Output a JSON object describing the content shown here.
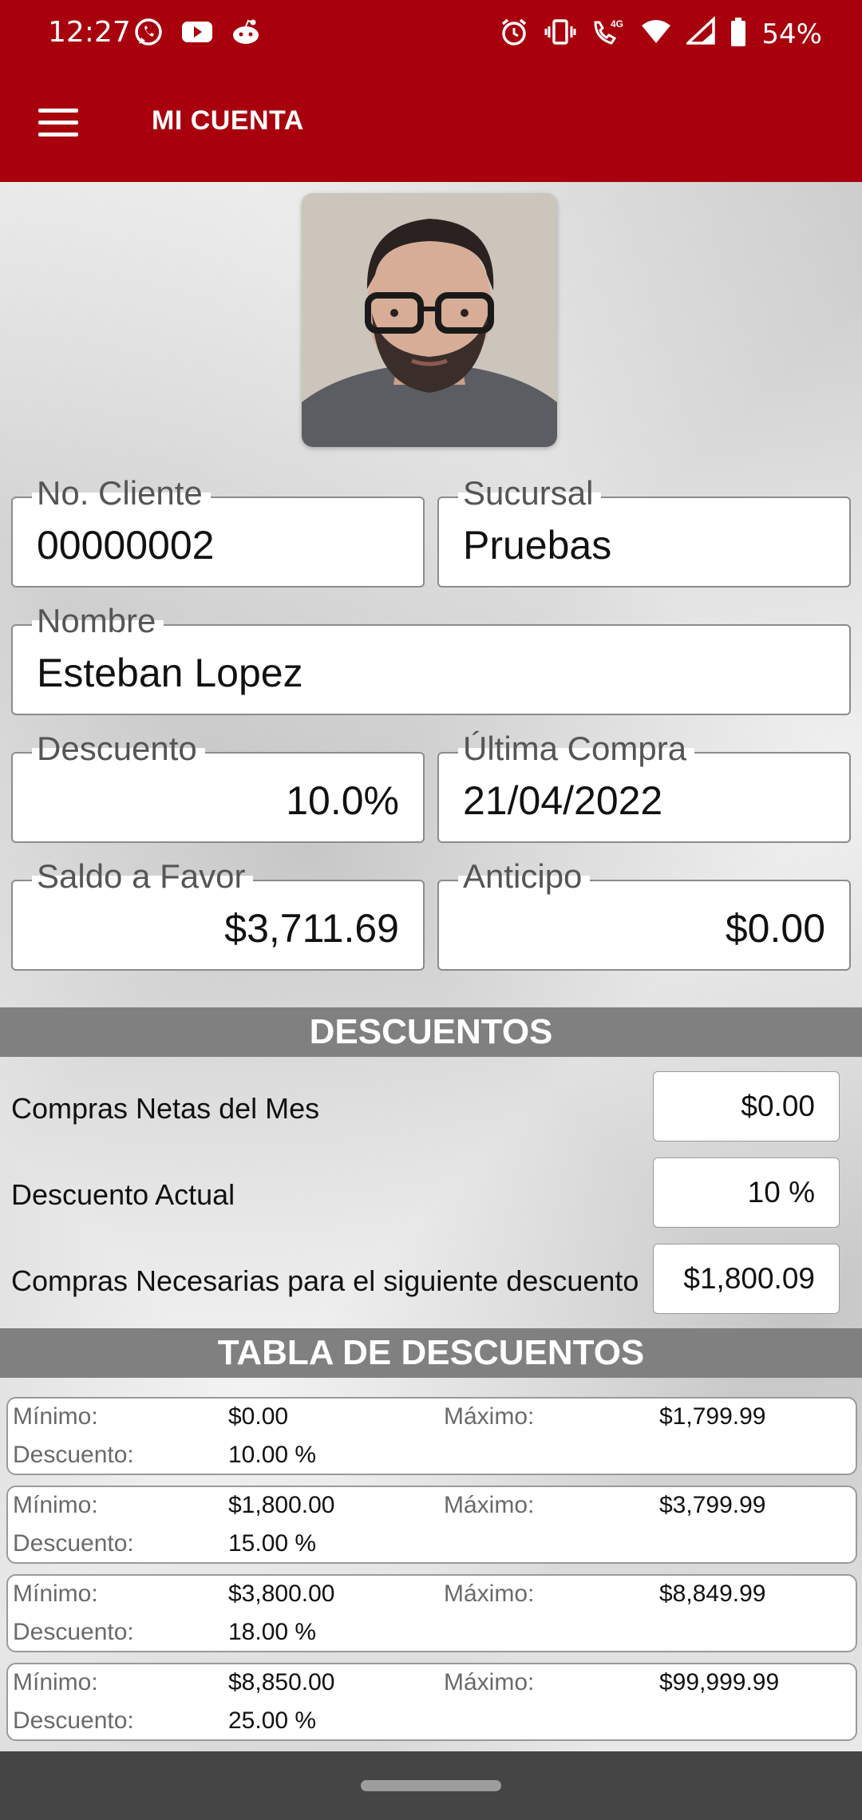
{
  "status_bar": {
    "time": "12:27",
    "notification_icons": [
      "whatsapp-icon",
      "youtube-icon",
      "reddit-icon"
    ],
    "system_icons": [
      "alarm-icon",
      "vibrate-icon",
      "volte-call-icon",
      "wifi-icon",
      "signal-icon",
      "battery-icon"
    ],
    "network_badge": "4G",
    "battery": "54%"
  },
  "app_bar": {
    "title": "MI CUENTA",
    "menu_icon": "hamburger-menu-icon",
    "color": "#a8000c"
  },
  "profile": {
    "client_no": {
      "label": "No. Cliente",
      "value": "00000002"
    },
    "branch": {
      "label": "Sucursal",
      "value": "Pruebas"
    },
    "name": {
      "label": "Nombre",
      "value": "Esteban Lopez"
    },
    "discount": {
      "label": "Descuento",
      "value": "10.0%"
    },
    "last_purchase": {
      "label": "Última Compra",
      "value": "21/04/2022"
    },
    "balance": {
      "label": "Saldo a Favor",
      "value": "$3,711.69"
    },
    "advance": {
      "label": "Anticipo",
      "value": "$0.00"
    }
  },
  "descuentos": {
    "header": "DESCUENTOS",
    "rows": [
      {
        "label": "Compras Netas del Mes",
        "value": "$0.00"
      },
      {
        "label": "Descuento Actual",
        "value": "10 %"
      },
      {
        "label": "Compras Necesarias para el siguiente descuento",
        "value": "$1,800.09"
      }
    ]
  },
  "tabla": {
    "header": "TABLA DE DESCUENTOS",
    "labels": {
      "min": "Mínimo:",
      "max": "Máximo:",
      "discount": "Descuento:"
    },
    "tiers": [
      {
        "min": "$0.00",
        "max": "$1,799.99",
        "discount": "10.00 %"
      },
      {
        "min": "$1,800.00",
        "max": "$3,799.99",
        "discount": "15.00 %"
      },
      {
        "min": "$3,800.00",
        "max": "$8,849.99",
        "discount": "18.00 %"
      },
      {
        "min": "$8,850.00",
        "max": "$99,999.99",
        "discount": "25.00 %"
      }
    ]
  }
}
